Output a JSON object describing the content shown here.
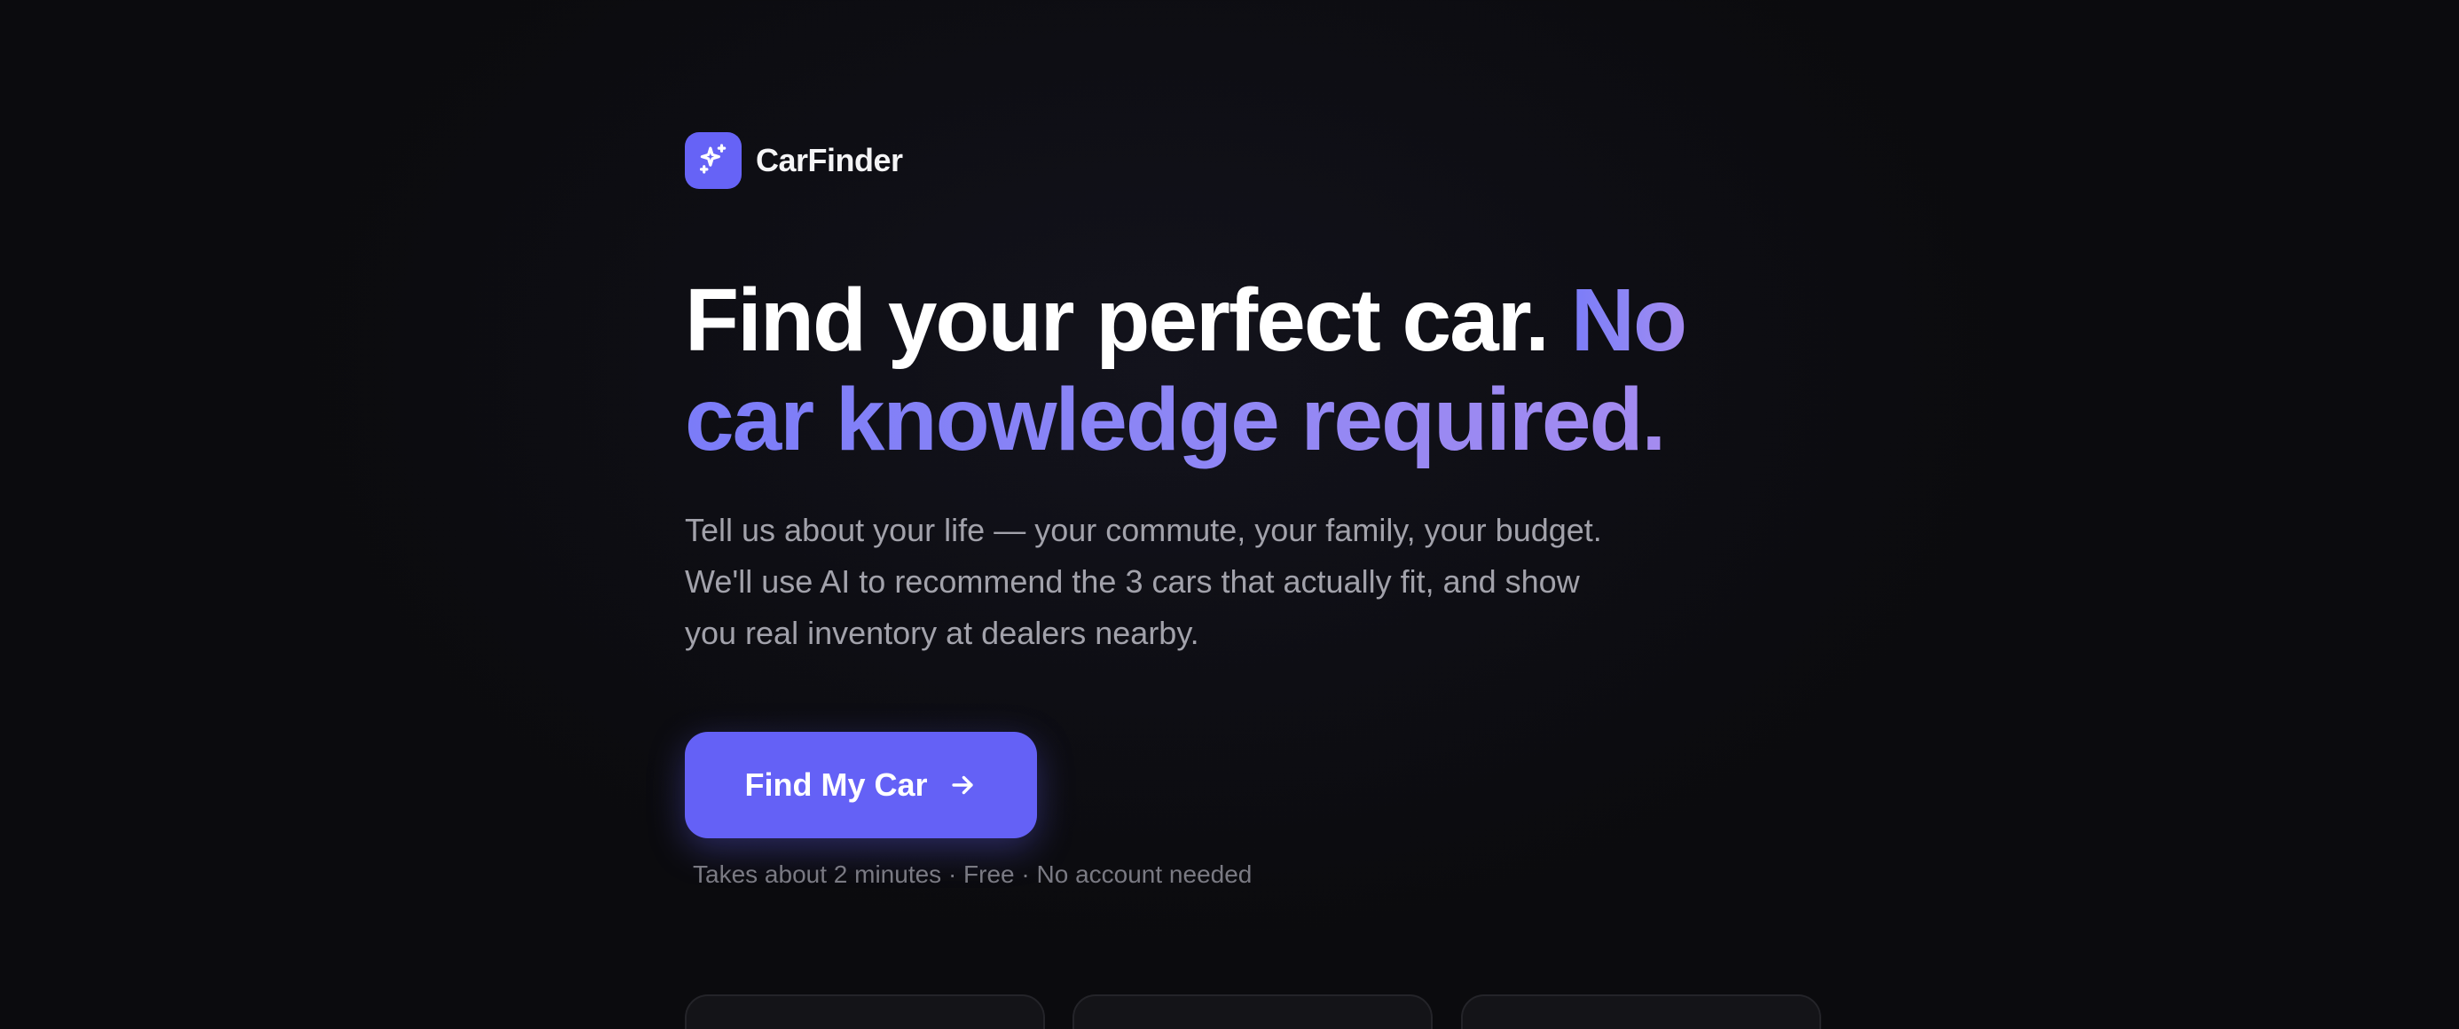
{
  "brand": {
    "name": "CarFinder",
    "logo_icon": "sparkles-icon",
    "logo_color": "#6663f6"
  },
  "hero": {
    "headline_primary": "Find your perfect car.",
    "headline_accent_line1": "No",
    "headline_accent_line2": "car knowledge required.",
    "subtitle_line1": "Tell us about your life — your commute, your family, your budget.",
    "subtitle_line2": "We'll use AI to recommend the 3 cars that actually fit, and show",
    "subtitle_line3": "you real inventory at dealers nearby."
  },
  "cta": {
    "label": "Find My Car",
    "icon": "arrow-right-icon",
    "color": "#6461f6"
  },
  "footnote": "Takes about 2 minutes · Free · No account needed",
  "theme": {
    "background": "#0b0b0e",
    "accent_gradient_start": "#7b7cf8",
    "accent_gradient_end": "#a48bf0"
  }
}
